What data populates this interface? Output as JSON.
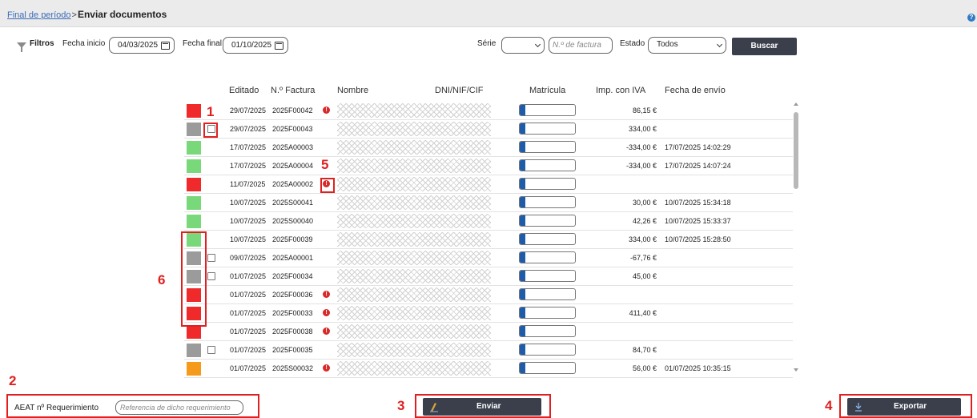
{
  "header": {
    "breadcrumb_link": "Final de período",
    "separator": ">",
    "title": "Enviar documentos",
    "help_label": "?"
  },
  "filters": {
    "label": "Filtros",
    "fecha_inicio_label": "Fecha inicio",
    "fecha_inicio_value": "04/03/2025",
    "fecha_final_label": "Fecha final",
    "fecha_final_value": "01/10/2025",
    "serie_label": "Série",
    "serie_value": "",
    "factura_placeholder": "N.º de factura",
    "estado_label": "Estado",
    "estado_value": "Todos",
    "buscar_label": "Buscar"
  },
  "table": {
    "headers": [
      "Editado",
      "N.º Factura",
      "Nombre",
      "DNI/NIF/CIF",
      "Matrícula",
      "Imp. con IVA",
      "Fecha de envío"
    ],
    "status_colors": {
      "red": "#f02a2a",
      "gray": "#9b9b9b",
      "green": "#79d97a",
      "orange": "#f59a1a"
    },
    "rows": [
      {
        "status": "red",
        "checkbox": false,
        "editado": "29/07/2025",
        "factura": "2025F00042",
        "warning": true,
        "importe": "86,15 €",
        "fecha_envio": ""
      },
      {
        "status": "gray",
        "checkbox": true,
        "editado": "29/07/2025",
        "factura": "2025F00043",
        "warning": false,
        "importe": "334,00 €",
        "fecha_envio": ""
      },
      {
        "status": "green",
        "checkbox": false,
        "editado": "17/07/2025",
        "factura": "2025A00003",
        "warning": false,
        "importe": "-334,00 €",
        "fecha_envio": "17/07/2025 14:02:29"
      },
      {
        "status": "green",
        "checkbox": false,
        "editado": "17/07/2025",
        "factura": "2025A00004",
        "warning": false,
        "importe": "-334,00 €",
        "fecha_envio": "17/07/2025 14:07:24"
      },
      {
        "status": "red",
        "checkbox": false,
        "editado": "11/07/2025",
        "factura": "2025A00002",
        "warning": true,
        "importe": "",
        "fecha_envio": ""
      },
      {
        "status": "green",
        "checkbox": false,
        "editado": "10/07/2025",
        "factura": "2025S00041",
        "warning": false,
        "importe": "30,00 €",
        "fecha_envio": "10/07/2025 15:34:18"
      },
      {
        "status": "green",
        "checkbox": false,
        "editado": "10/07/2025",
        "factura": "2025S00040",
        "warning": false,
        "importe": "42,26 €",
        "fecha_envio": "10/07/2025 15:33:37"
      },
      {
        "status": "green",
        "checkbox": false,
        "editado": "10/07/2025",
        "factura": "2025F00039",
        "warning": false,
        "importe": "334,00 €",
        "fecha_envio": "10/07/2025 15:28:50"
      },
      {
        "status": "gray",
        "checkbox": true,
        "editado": "09/07/2025",
        "factura": "2025A00001",
        "warning": false,
        "importe": "-67,76 €",
        "fecha_envio": ""
      },
      {
        "status": "gray",
        "checkbox": true,
        "editado": "01/07/2025",
        "factura": "2025F00034",
        "warning": false,
        "importe": "45,00 €",
        "fecha_envio": ""
      },
      {
        "status": "red",
        "checkbox": false,
        "editado": "01/07/2025",
        "factura": "2025F00036",
        "warning": true,
        "importe": "",
        "fecha_envio": ""
      },
      {
        "status": "red",
        "checkbox": false,
        "editado": "01/07/2025",
        "factura": "2025F00033",
        "warning": true,
        "importe": "411,40 €",
        "fecha_envio": ""
      },
      {
        "status": "red",
        "checkbox": false,
        "editado": "01/07/2025",
        "factura": "2025F00038",
        "warning": true,
        "importe": "",
        "fecha_envio": ""
      },
      {
        "status": "gray",
        "checkbox": true,
        "editado": "01/07/2025",
        "factura": "2025F00035",
        "warning": false,
        "importe": "84,70 €",
        "fecha_envio": ""
      },
      {
        "status": "orange",
        "checkbox": false,
        "editado": "01/07/2025",
        "factura": "2025S00032",
        "warning": true,
        "importe": "56,00 €",
        "fecha_envio": "01/07/2025 10:35:15"
      }
    ]
  },
  "annotations": {
    "n1": "1",
    "n2": "2",
    "n3": "3",
    "n4": "4",
    "n5": "5",
    "n6": "6",
    "color": "#e02020"
  },
  "footer": {
    "aeat_label": "AEAT nº Requerimiento",
    "aeat_placeholder": "Referencia de dicho requerimiento",
    "enviar_label": "Enviar",
    "exportar_label": "Exportar"
  }
}
